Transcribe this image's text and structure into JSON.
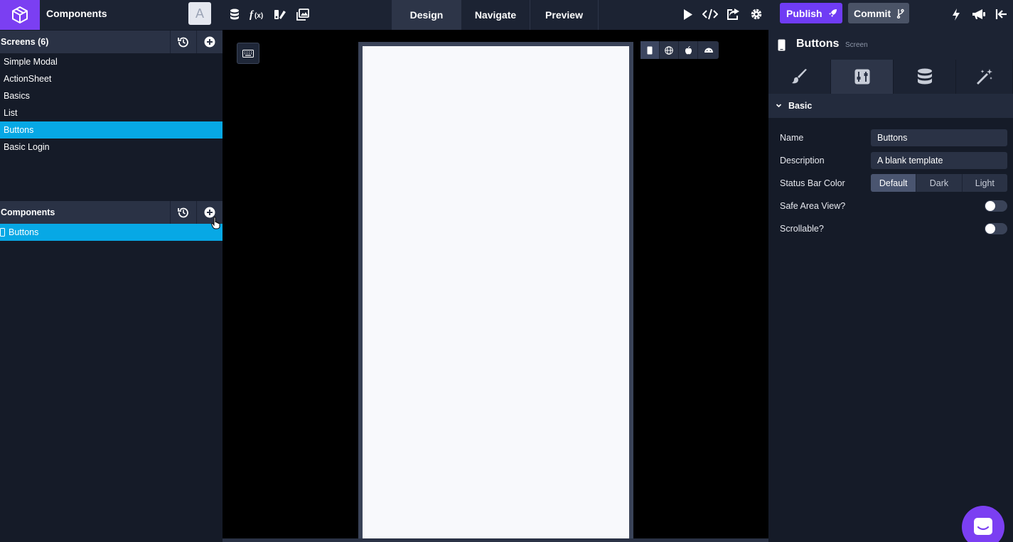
{
  "app": {
    "title": "Components",
    "avatar_initial": "A"
  },
  "topbar": {
    "tabs": [
      {
        "label": "Design"
      },
      {
        "label": "Navigate"
      },
      {
        "label": "Preview"
      }
    ],
    "publish_label": "Publish",
    "commit_label": "Commit"
  },
  "screens": {
    "title": "Screens (6)",
    "items": [
      {
        "label": "Simple Modal"
      },
      {
        "label": "ActionSheet"
      },
      {
        "label": "Basics"
      },
      {
        "label": "List"
      },
      {
        "label": "Buttons"
      },
      {
        "label": "Basic Login"
      }
    ]
  },
  "components": {
    "title": "Components",
    "items": [
      {
        "label": "Buttons"
      }
    ]
  },
  "inspector": {
    "title": "Buttons",
    "subtitle": "Screen",
    "section": "Basic",
    "name_label": "Name",
    "name_value": "Buttons",
    "description_label": "Description",
    "description_value": "A blank template",
    "status_bar_label": "Status Bar Color",
    "status_bar_options": [
      {
        "label": "Default"
      },
      {
        "label": "Dark"
      },
      {
        "label": "Light"
      }
    ],
    "safe_area_label": "Safe Area View?",
    "scrollable_label": "Scrollable?"
  },
  "colors": {
    "accent": "#7b3ff2",
    "active_item": "#07a8e5",
    "panel_bg": "#151b28",
    "topbar_bg": "#1c2333"
  }
}
